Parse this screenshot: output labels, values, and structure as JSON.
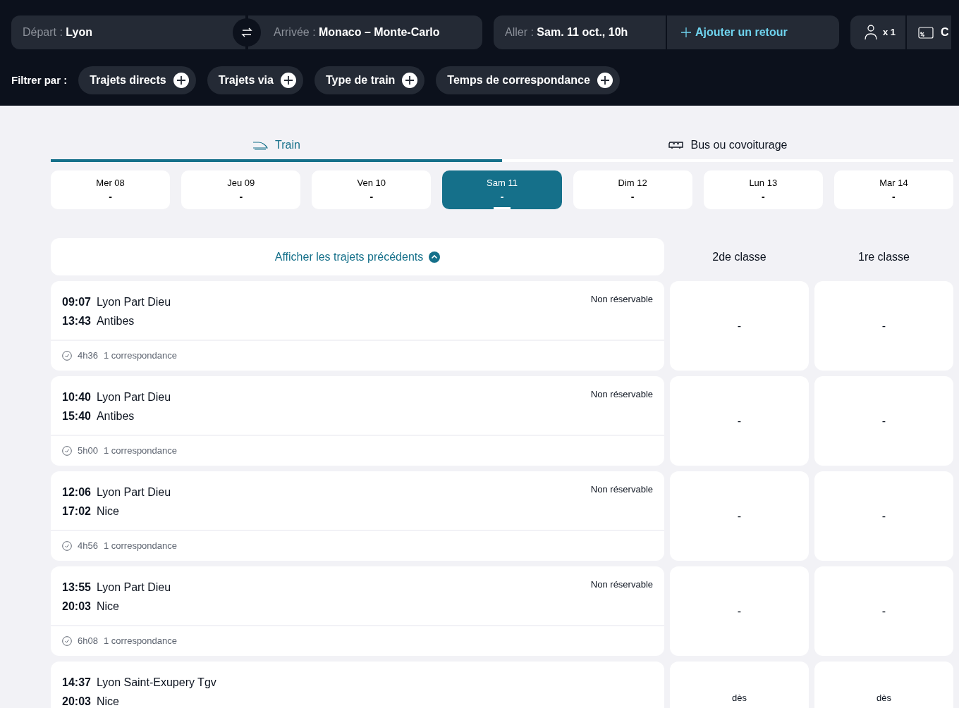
{
  "search": {
    "departure": {
      "label": "Départ :",
      "value": "Lyon"
    },
    "arrival": {
      "label": "Arrivée :",
      "value": "Monaco – Monte-Carlo"
    },
    "outbound": {
      "label": "Aller :",
      "value": "Sam. 11 oct., 10h"
    },
    "add_return": "Ajouter un retour",
    "passengers": "x 1",
    "discount": "C"
  },
  "filters": {
    "label": "Filtrer par :",
    "items": [
      "Trajets directs",
      "Trajets via",
      "Type de train",
      "Temps de correspondance"
    ]
  },
  "modes": [
    {
      "kind": "train",
      "label": "Train",
      "selected": true
    },
    {
      "kind": "bus",
      "label": "Bus ou covoiturage",
      "selected": false
    }
  ],
  "dates": [
    {
      "day": "Mer 08",
      "price": "-",
      "selected": false
    },
    {
      "day": "Jeu 09",
      "price": "-",
      "selected": false
    },
    {
      "day": "Ven 10",
      "price": "-",
      "selected": false
    },
    {
      "day": "Sam 11",
      "price": "-",
      "selected": true
    },
    {
      "day": "Dim 12",
      "price": "-",
      "selected": false
    },
    {
      "day": "Lun 13",
      "price": "-",
      "selected": false
    },
    {
      "day": "Mar 14",
      "price": "-",
      "selected": false
    }
  ],
  "previous_link": "Afficher les trajets précédents",
  "class_columns": [
    "2de classe",
    "1re classe"
  ],
  "journeys": [
    {
      "dep_time": "09:07",
      "dep_station": "Lyon Part Dieu",
      "arr_time": "13:43",
      "arr_station": "Antibes",
      "status": "Non réservable",
      "duration": "4h36",
      "changes": "1 correspondance",
      "prices": [
        "-",
        "-"
      ]
    },
    {
      "dep_time": "10:40",
      "dep_station": "Lyon Part Dieu",
      "arr_time": "15:40",
      "arr_station": "Antibes",
      "status": "Non réservable",
      "duration": "5h00",
      "changes": "1 correspondance",
      "prices": [
        "-",
        "-"
      ]
    },
    {
      "dep_time": "12:06",
      "dep_station": "Lyon Part Dieu",
      "arr_time": "17:02",
      "arr_station": "Nice",
      "status": "Non réservable",
      "duration": "4h56",
      "changes": "1 correspondance",
      "prices": [
        "-",
        "-"
      ]
    },
    {
      "dep_time": "13:55",
      "dep_station": "Lyon Part Dieu",
      "arr_time": "20:03",
      "arr_station": "Nice",
      "status": "Non réservable",
      "duration": "6h08",
      "changes": "1 correspondance",
      "prices": [
        "-",
        "-"
      ]
    },
    {
      "dep_time": "14:37",
      "dep_station": "Lyon Saint-Exupery Tgv",
      "arr_time": "20:03",
      "arr_station": "Nice",
      "prices": [
        "dès",
        "dès"
      ]
    }
  ]
}
